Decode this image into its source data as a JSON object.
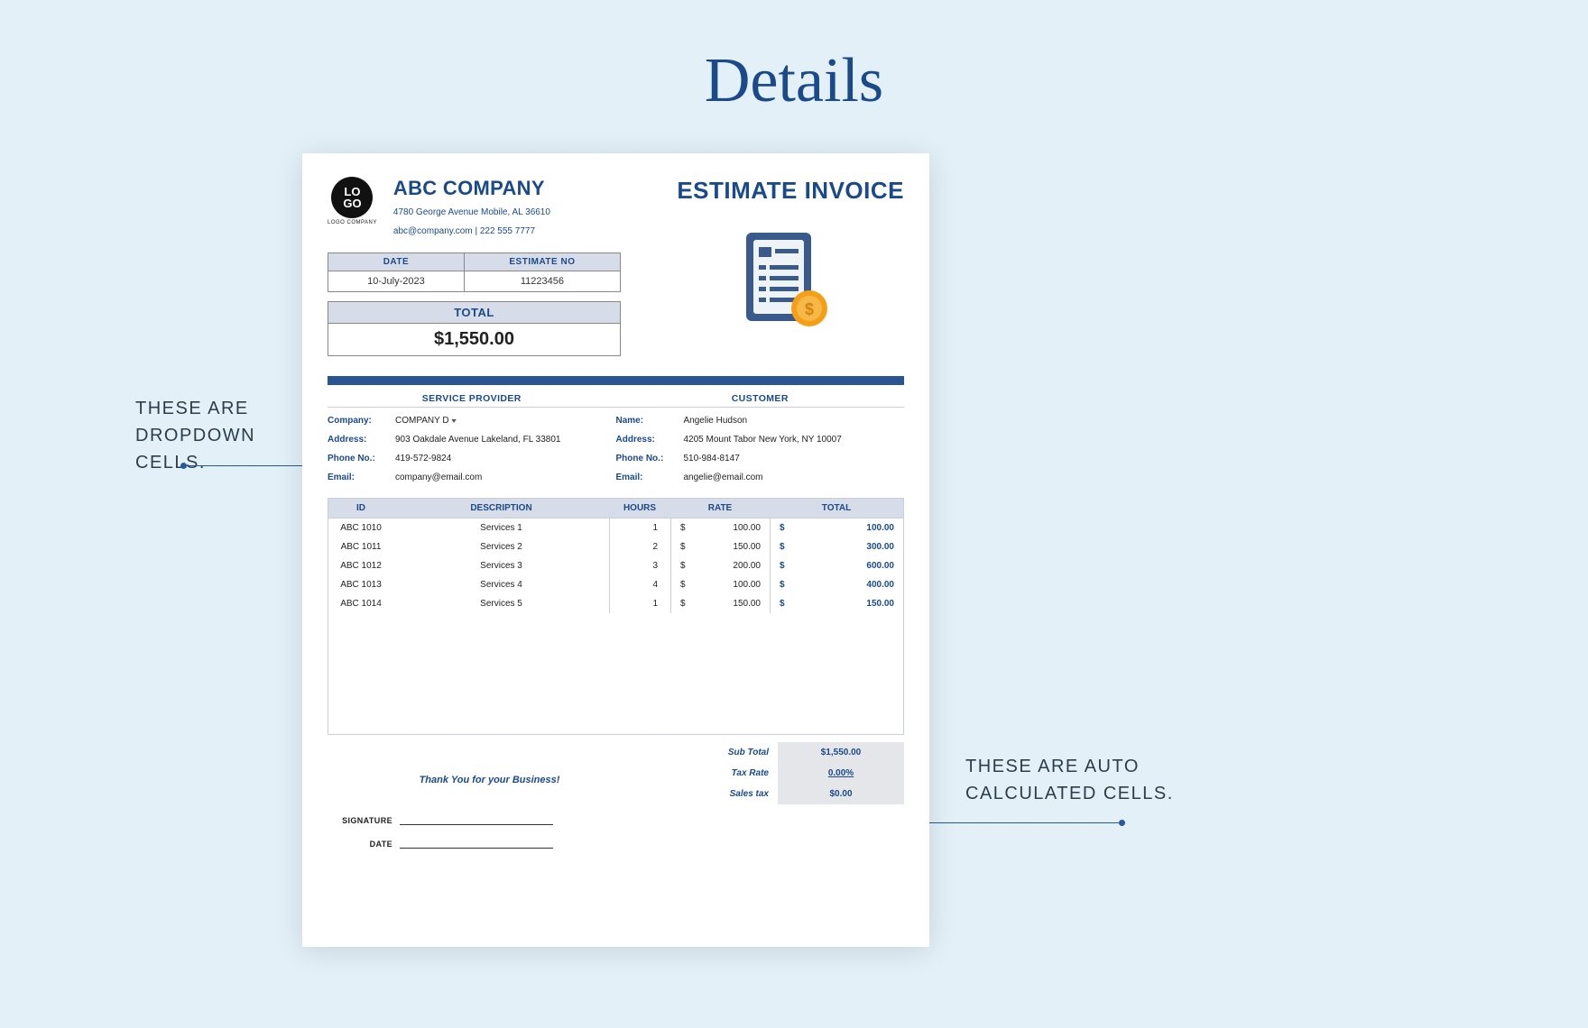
{
  "page_title": "Details",
  "annotations": {
    "dropdown": "THESE ARE\nDROPDOWN\nCELLS.",
    "autocalc": "THESE ARE AUTO\nCALCULATED CELLS."
  },
  "logo": {
    "text": "LO\nGO",
    "sub": "LOGO COMPANY"
  },
  "company": {
    "name": "ABC COMPANY",
    "address": "4780 George Avenue Mobile, AL 36610",
    "contact": "abc@company.com  |  222 555 7777"
  },
  "doc_title": "ESTIMATE INVOICE",
  "date_est": {
    "headers": {
      "date": "DATE",
      "estno": "ESTIMATE NO"
    },
    "date": "10-July-2023",
    "estno": "11223456"
  },
  "total_block": {
    "label": "TOTAL",
    "value": "$1,550.00"
  },
  "sections": {
    "provider": "SERVICE PROVIDER",
    "customer": "CUSTOMER"
  },
  "provider": {
    "company_label": "Company:",
    "company": "COMPANY D",
    "address_label": "Address:",
    "address": "903 Oakdale Avenue Lakeland, FL 33801",
    "phone_label": "Phone No.:",
    "phone": "419-572-9824",
    "email_label": "Email:",
    "email": "company@email.com"
  },
  "customer": {
    "name_label": "Name:",
    "name": "Angelie Hudson",
    "address_label": "Address:",
    "address": "4205 Mount Tabor New York, NY 10007",
    "phone_label": "Phone No.:",
    "phone": "510-984-8147",
    "email_label": "Email:",
    "email": "angelie@email.com"
  },
  "items": {
    "headers": {
      "id": "ID",
      "desc": "DESCRIPTION",
      "hours": "HOURS",
      "rate": "RATE",
      "total": "TOTAL"
    },
    "currency": "$",
    "rows": [
      {
        "id": "ABC 1010",
        "desc": "Services 1",
        "hours": "1",
        "rate": "100.00",
        "total": "100.00"
      },
      {
        "id": "ABC 1011",
        "desc": "Services 2",
        "hours": "2",
        "rate": "150.00",
        "total": "300.00"
      },
      {
        "id": "ABC 1012",
        "desc": "Services 3",
        "hours": "3",
        "rate": "200.00",
        "total": "600.00"
      },
      {
        "id": "ABC 1013",
        "desc": "Services 4",
        "hours": "4",
        "rate": "100.00",
        "total": "400.00"
      },
      {
        "id": "ABC 1014",
        "desc": "Services 5",
        "hours": "1",
        "rate": "150.00",
        "total": "150.00"
      }
    ]
  },
  "footer": {
    "thanks": "Thank You for your Business!",
    "signature_label": "SIGNATURE",
    "date_label": "DATE"
  },
  "summary": {
    "subtotal_label": "Sub Total",
    "subtotal": "$1,550.00",
    "taxrate_label": "Tax Rate",
    "taxrate": "0.00%",
    "salestax_label": "Sales tax",
    "salestax": "$0.00"
  }
}
